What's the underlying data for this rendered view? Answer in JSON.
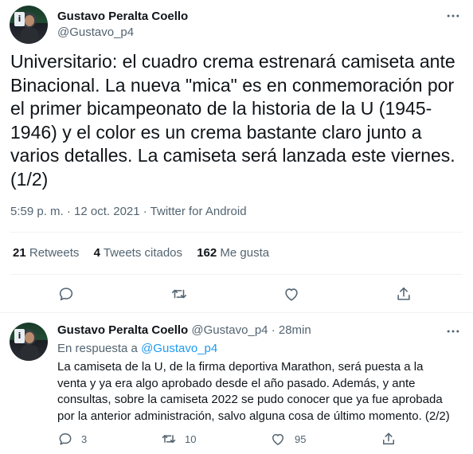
{
  "main_tweet": {
    "author_name": "Gustavo Peralta Coello",
    "author_handle": "@Gustavo_p4",
    "text": "Universitario: el cuadro crema estrenará camiseta ante Binacional. La nueva \"mica\" es en conmemoración por el primer bicampeonato de la historia de la U (1945-1946) y el color es un crema bastante claro junto a varios detalles. La camiseta será lanzada este viernes. (1/2)",
    "meta": "5:59 p. m. · 12 oct. 2021 · Twitter for Android",
    "stats": {
      "retweets_count": "21",
      "retweets_label": "Retweets",
      "quotes_count": "4",
      "quotes_label": "Tweets citados",
      "likes_count": "162",
      "likes_label": "Me gusta"
    }
  },
  "reply_tweet": {
    "author_name": "Gustavo Peralta Coello",
    "author_handle": "@Gustavo_p4",
    "time": "· 28min",
    "reply_prefix": "En respuesta a",
    "reply_mention": "@Gustavo_p4",
    "text": "La camiseta de la U, de la firma deportiva Marathon, será puesta a la venta y ya era algo aprobado desde el año pasado. Además, y ante consultas, sobre la camiseta 2022 se pudo conocer que ya fue aprobada por la anterior administración, salvo alguna cosa de último momento. (2/2)",
    "replies_count": "3",
    "retweets_count": "10",
    "likes_count": "95"
  },
  "icons": {
    "more": "more-dots-icon",
    "reply": "reply-bubble-icon",
    "retweet": "retweet-arrows-icon",
    "like": "heart-icon",
    "share": "share-upload-icon"
  },
  "colors": {
    "text": "#0f1419",
    "secondary": "#536471",
    "link": "#1d9bf0",
    "divider": "#eff3f4"
  }
}
